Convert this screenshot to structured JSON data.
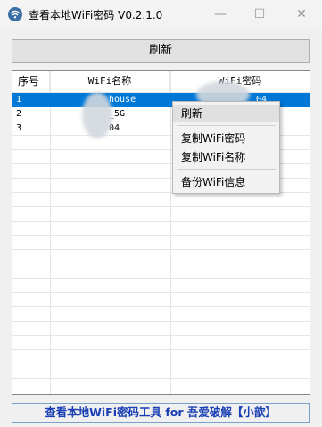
{
  "window": {
    "title": "查看本地WiFi密码 V0.2.1.0",
    "min_label": "—",
    "max_label": "☐",
    "close_label": "✕"
  },
  "toolbar": {
    "refresh_label": "刷新"
  },
  "table": {
    "columns": [
      "序号",
      "WiFi名称",
      "WiFi密码"
    ],
    "rows": [
      {
        "index": "1",
        "name": "house",
        "password": "04"
      },
      {
        "index": "2",
        "name": "_5G",
        "password": ""
      },
      {
        "index": "3",
        "name": "04",
        "password": ""
      }
    ]
  },
  "context_menu": {
    "items": [
      "刷新",
      "复制WiFi密码",
      "复制WiFi名称",
      "备份WiFi信息"
    ]
  },
  "footer": {
    "text": "查看本地WiFi密码工具 for 吾爱破解【小歆】"
  },
  "colors": {
    "selection": "#0078d7",
    "footer_text": "#1a3fb5"
  }
}
